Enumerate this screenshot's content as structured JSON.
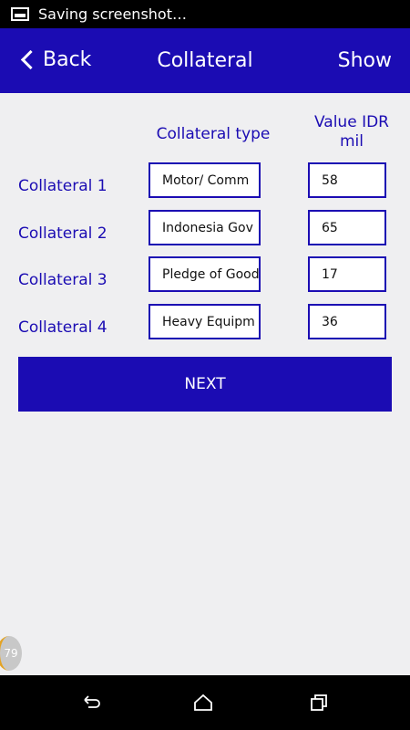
{
  "status_bar": {
    "text": "Saving screenshot…",
    "icon": "image-icon"
  },
  "app_bar": {
    "back_label": "Back",
    "title": "Collateral",
    "show_label": "Show"
  },
  "table": {
    "type_header": "Collateral type",
    "value_header": "Value IDR mil",
    "rows": [
      {
        "label": "Collateral  1",
        "type": "Motor/ Comm",
        "value": "58"
      },
      {
        "label": "Collateral  2",
        "type": "Indonesia Gov",
        "value": "65"
      },
      {
        "label": "Collateral  3",
        "type": "Pledge of Good",
        "value": "17"
      },
      {
        "label": "Collateral  4",
        "type": "Heavy Equipm",
        "value": "36"
      }
    ]
  },
  "next_label": "NEXT",
  "badge_count": "79",
  "colors": {
    "primary": "#1b0cb3",
    "background": "#efeff1",
    "badge_accent": "#e4a323"
  },
  "nav_bar": {
    "icons": [
      "back-icon",
      "home-icon",
      "recents-icon"
    ]
  }
}
